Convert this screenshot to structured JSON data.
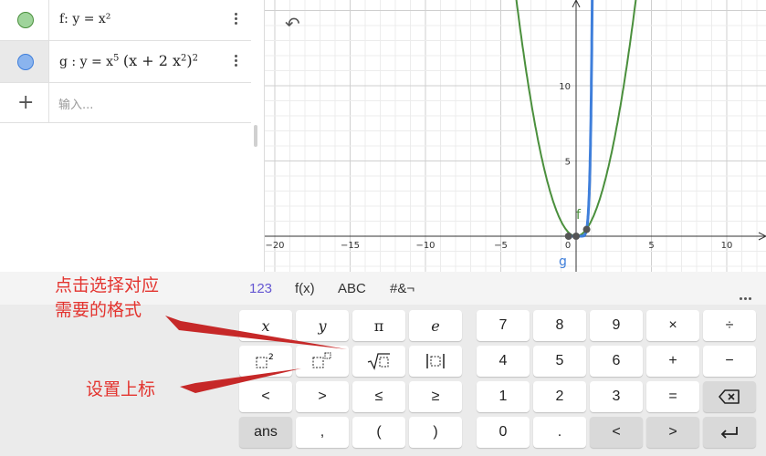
{
  "colors": {
    "f": "#4a8f3c",
    "g": "#3f7fdb",
    "accent": "#6557d2",
    "annotation": "#e3342f"
  },
  "algebra": {
    "f": {
      "name": "f:",
      "expr": "y = x²",
      "marker_color": "#9fd49b"
    },
    "g": {
      "name": "g :",
      "lhs": "y = x",
      "exp1": "5",
      "paren": "(x + 2 x",
      "exp2": "2",
      "close": ")",
      "exp3": "2",
      "marker_color": "#8ab4ee"
    },
    "input_placeholder": "输入..."
  },
  "graph": {
    "x_ticks": [
      "−20",
      "−15",
      "−10",
      "−5",
      "0",
      "5",
      "10"
    ],
    "y_ticks": [
      "10",
      "5"
    ],
    "labels": {
      "f": "f",
      "g": "g"
    }
  },
  "keyboard": {
    "tabs": [
      "123",
      "f(x)",
      "ABC",
      "#&¬"
    ],
    "keys": {
      "x": "x",
      "y": "y",
      "pi": "π",
      "e": "e",
      "seven": "7",
      "eight": "8",
      "nine": "9",
      "times": "×",
      "divide": "÷",
      "four": "4",
      "five": "5",
      "six": "6",
      "plus": "+",
      "minus": "−",
      "lt": "<",
      "gt": ">",
      "le": "≤",
      "ge": "≥",
      "one": "1",
      "two": "2",
      "three": "3",
      "equals": "=",
      "ans": "ans",
      "comma": ",",
      "lparen": "(",
      "rparen": ")",
      "zero": "0",
      "dot": ".",
      "left": "<",
      "right": ">"
    }
  },
  "annotations": {
    "format_line1": "点击选择对应",
    "format_line2": "需要的格式",
    "superscript": "设置上标"
  }
}
